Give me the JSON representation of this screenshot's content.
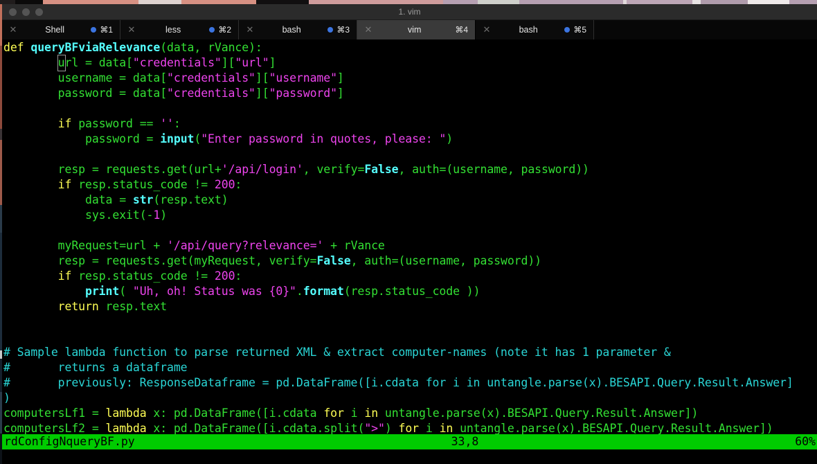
{
  "window": {
    "title": "1. vim",
    "traffic_lights": [
      "close",
      "minimize",
      "zoom"
    ]
  },
  "tabs": [
    {
      "label": "Shell",
      "shortcut": "⌘1",
      "close": "✕",
      "active": false,
      "has_activity_dot": true
    },
    {
      "label": "less",
      "shortcut": "⌘2",
      "close": "✕",
      "active": false,
      "has_activity_dot": true
    },
    {
      "label": "bash",
      "shortcut": "⌘3",
      "close": "✕",
      "active": false,
      "has_activity_dot": true
    },
    {
      "label": "vim",
      "shortcut": "⌘4",
      "close": "✕",
      "active": true,
      "has_activity_dot": false
    },
    {
      "label": "bash",
      "shortcut": "⌘5",
      "close": "✕",
      "active": false,
      "has_activity_dot": true
    }
  ],
  "editor": {
    "cursor_char": "u",
    "lines": [
      "def queryBFviaRelevance(data, rVance):",
      "        url = data[\"credentials\"][\"url\"]",
      "        username = data[\"credentials\"][\"username\"]",
      "        password = data[\"credentials\"][\"password\"]",
      "",
      "        if password == '':",
      "            password = input(\"Enter password in quotes, please: \")",
      "",
      "        resp = requests.get(url+'/api/login', verify=False, auth=(username, password))",
      "        if resp.status_code != 200:",
      "            data = str(resp.text)",
      "            sys.exit(-1)",
      "",
      "        myRequest=url + '/api/query?relevance=' + rVance",
      "        resp = requests.get(myRequest, verify=False, auth=(username, password))",
      "        if resp.status_code != 200:",
      "            print( \"Uh, oh! Status was {0}\".format(resp.status_code ))",
      "        return resp.text",
      "",
      "",
      "# Sample lambda function to parse returned XML & extract computer-names (note it has 1 parameter &",
      "#       returns a dataframe",
      "#       previously: ResponseDataframe = pd.DataFrame([i.cdata for i in untangle.parse(x).BESAPI.Query.Result.Answer]",
      ")",
      "computersLf1 = lambda x: pd.DataFrame([i.cdata for i in untangle.parse(x).BESAPI.Query.Result.Answer])",
      "computersLf2 = lambda x: pd.DataFrame([i.cdata.split(\">\") for i in untangle.parse(x).BESAPI.Query.Result.Answer])"
    ]
  },
  "statusline": {
    "filename": "rdConfigNqueryBF.py",
    "position": "33,8",
    "percent": "60%"
  },
  "colors": {
    "status_bg": "#00cc00",
    "status_fg": "#000000",
    "keyword": "#ffff55",
    "builtin": "#55ffff",
    "identifier": "#33e033",
    "string": "#ee44ee",
    "comment": "#2ad6d6",
    "terminal_bg": "#000000",
    "tab_active_bg": "#3a3a3a",
    "activity_dot": "#3b74e0"
  }
}
